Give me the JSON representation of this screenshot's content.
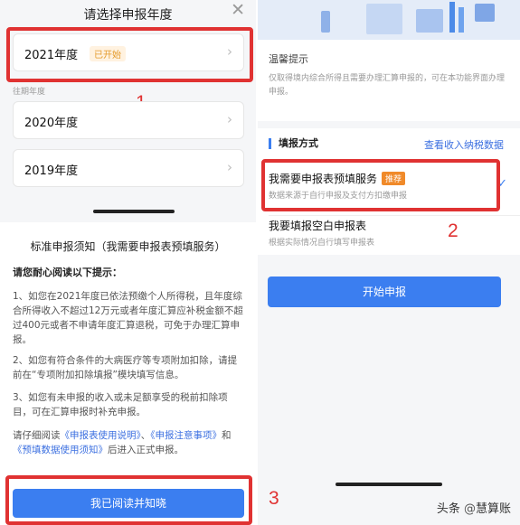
{
  "year_picker": {
    "title": "请选择申报年度",
    "close_icon": "close-icon",
    "current": {
      "year": "2021年度",
      "tag": "已开始"
    },
    "past_label": "往期年度",
    "past": [
      "2020年度",
      "2019年度"
    ]
  },
  "notice": {
    "title": "标准申报须知（我需要申报表预填服务）",
    "subtitle": "请您耐心阅读以下提示：",
    "para1": "1、如您在2021年度已依法预缴个人所得税，且年度综合所得收入不超过12万元或者年度汇算应补税金额不超过400元或者不申请年度汇算退税，可免于办理汇算申报。",
    "para2": "2、如您有符合条件的大病医疗等专项附加扣除，请提前在“专项附加扣除填报”模块填写信息。",
    "para3": "3、如您有未申报的收入或未足额享受的税前扣除项目，可在汇算申报时补充申报。",
    "para4_a": "请仔细阅读",
    "para4_link1": "《申报表使用说明》",
    "para4_b": "、",
    "para4_link2": "《申报注意事项》",
    "para4_c": "和",
    "para4_link3": "《预填数据使用须知》",
    "para4_d": "后进入正式申报。",
    "confirm_button": "我已阅读并知晓"
  },
  "tips": {
    "title": "温馨提示",
    "text": "仅取得境内综合所得且需要办理汇算申报的，可在本功能界面办理申报。"
  },
  "method": {
    "heading": "填报方式",
    "link": "查看收入纳税数据",
    "option1": {
      "title": "我需要申报表预填服务",
      "tag": "推荐",
      "sub": "数据来源于自行申报及支付方扣缴申报"
    },
    "option2": {
      "title": "我要填报空白申报表",
      "sub": "根据实际情况自行填写申报表"
    },
    "start_button": "开始申报"
  },
  "annotations": {
    "one": "1",
    "two": "2",
    "three": "3",
    "color": "#e03232"
  },
  "watermark": {
    "prefix": "头条",
    "at": "@",
    "name": "慧算账"
  },
  "colors": {
    "accent": "#3b7ef0",
    "tag_orange": "#f08a2a",
    "annotation_red": "#e03232"
  }
}
